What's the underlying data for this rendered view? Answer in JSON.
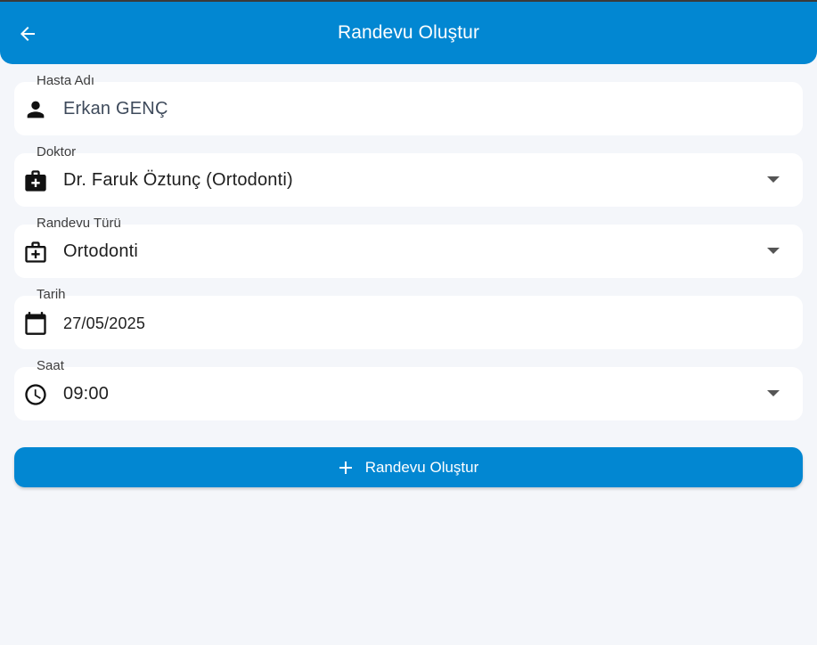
{
  "appbar": {
    "title": "Randevu Oluştur",
    "back_icon": "arrow-left-icon",
    "color": "#0287d2"
  },
  "fields": {
    "patient": {
      "label": "Hasta Adı",
      "value": "Erkan GENÇ",
      "icon": "person-icon"
    },
    "doctor": {
      "label": "Doktor",
      "value": "Dr. Faruk Öztunç (Ortodonti)",
      "icon": "medical-bag-icon"
    },
    "type": {
      "label": "Randevu Türü",
      "value": "Ortodonti",
      "icon": "medical-bag-outline-icon"
    },
    "date": {
      "label": "Tarih",
      "value": "27/05/2025",
      "icon": "calendar-icon"
    },
    "time": {
      "label": "Saat",
      "value": "09:00",
      "icon": "clock-icon"
    }
  },
  "submit": {
    "label": "Randevu Oluştur",
    "icon": "plus-icon"
  },
  "colors": {
    "background": "#f4f6fa",
    "accent": "#0287d2",
    "field_bg": "#ffffff"
  }
}
